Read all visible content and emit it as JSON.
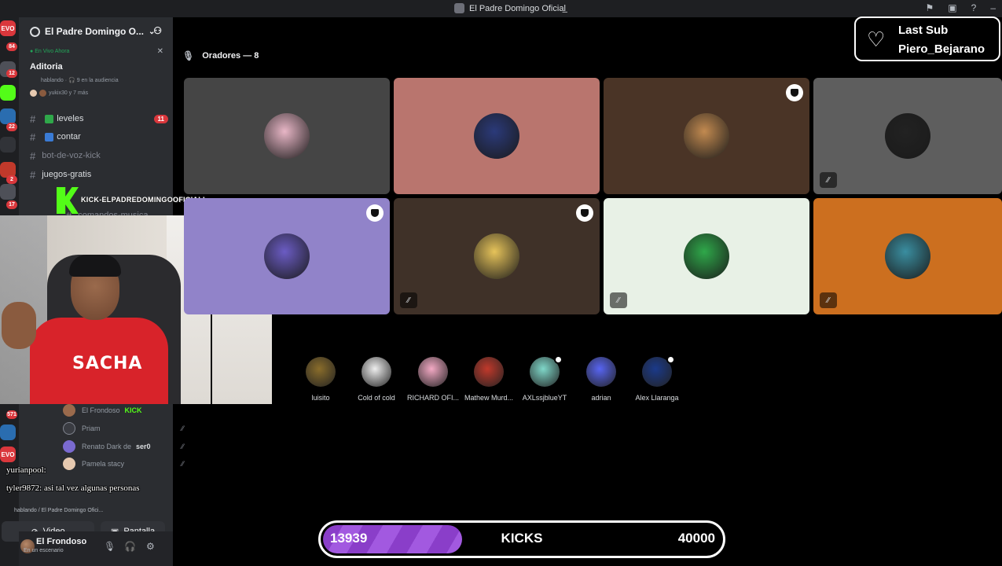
{
  "window": {
    "title": "El Padre Domingo Oficial̲"
  },
  "servers": {
    "badges": [
      "84",
      "12",
      "22",
      "2",
      "17",
      "571"
    ],
    "labels": [
      "EVO",
      "EVO"
    ]
  },
  "sidebar": {
    "server_name": "El Padre Domingo O...",
    "live": {
      "label": "En Vivo Ahora",
      "title": "Aditoria",
      "subtitle": "hablando · 🎧 9 en la audiencia",
      "users": "yukix30 y 7 más"
    },
    "channels": [
      {
        "name": "leveles",
        "prefix": "#",
        "badge": "11",
        "muted": false
      },
      {
        "name": "contar",
        "prefix": "#",
        "badge": "",
        "muted": false
      },
      {
        "name": "bot-de-voz-kick",
        "prefix": "#",
        "badge": "",
        "muted": true
      },
      {
        "name": "juegos-gratis",
        "prefix": "#",
        "badge": "",
        "muted": false
      },
      {
        "name": "comandos-musica",
        "prefix": "#",
        "badge": "",
        "muted": true
      }
    ],
    "kick_overlay": "KICK-ELPADREDOMINGOOFICIALL",
    "members": [
      {
        "name": "El Frondoso",
        "tag": "KICK",
        "color": "#9a6a4c"
      },
      {
        "name": "Priam",
        "tag": "",
        "color": "#3a3c42"
      },
      {
        "name": "Renato Dark de",
        "tag": "ser0",
        "color": "#7a6ad0"
      },
      {
        "name": "Pamela stacy",
        "tag": "",
        "color": "#e6c9b0"
      }
    ],
    "chat_overlay": [
      "yurianpool:",
      "tyler9872: asi tal vez algunas personas"
    ],
    "voice_status": "hablando / El Padre Domingo Ofici...",
    "video_button": "Video",
    "screen_button": "Pantalla",
    "user": {
      "name": "El Frondoso",
      "status": "En un escenario"
    }
  },
  "webcam": {
    "shirt_text": "SACHA"
  },
  "stage": {
    "speakers_header": "Oradores — 8",
    "speakers": [
      {
        "color": "#454545",
        "shield": false,
        "muted": false,
        "pfp": "#e8b6c6"
      },
      {
        "color": "#b9756e",
        "shield": false,
        "muted": false,
        "pfp": "#2b3a7a"
      },
      {
        "color": "#4a3426",
        "shield": true,
        "muted": false,
        "pfp": "#c28a50"
      },
      {
        "color": "#5e5e5e",
        "shield": false,
        "muted": true,
        "pfp": "#222222"
      },
      {
        "color": "#9183c9",
        "shield": true,
        "muted": false,
        "pfp": "#6b5cc4"
      },
      {
        "color": "#3f3128",
        "shield": true,
        "muted": true,
        "pfp": "#e6c35a"
      },
      {
        "color": "#e8f1e6",
        "shield": false,
        "muted": true,
        "pfp": "#2fa84a"
      },
      {
        "color": "#cc6f1f",
        "shield": false,
        "muted": true,
        "pfp": "#3a8ea0"
      }
    ],
    "audience": [
      {
        "name": "luisito",
        "color": "#8a6d2b",
        "badge": false
      },
      {
        "name": "Cold of cold",
        "color": "#eeeeee",
        "badge": false
      },
      {
        "name": "RICHARD OFI...",
        "color": "#f3a9c4",
        "badge": false
      },
      {
        "name": "Mathew Murd...",
        "color": "#c0392b",
        "badge": false
      },
      {
        "name": "AXLssjblueYT",
        "color": "#7fd7c9",
        "badge": true
      },
      {
        "name": "adrian",
        "color": "#5865f2",
        "badge": false
      },
      {
        "name": "Alex Llaranga",
        "color": "#1b3a8a",
        "badge": true
      }
    ]
  },
  "last_sub": {
    "title": "Last Sub",
    "user": "Piero_Bejarano"
  },
  "goal": {
    "current": "13939",
    "label": "KICKS",
    "target": "40000",
    "progress": 0.35
  },
  "colors": {
    "accent": "#5865f2",
    "kick": "#53fc18",
    "alert": "#da373c",
    "goal": "#8a3ec9"
  }
}
